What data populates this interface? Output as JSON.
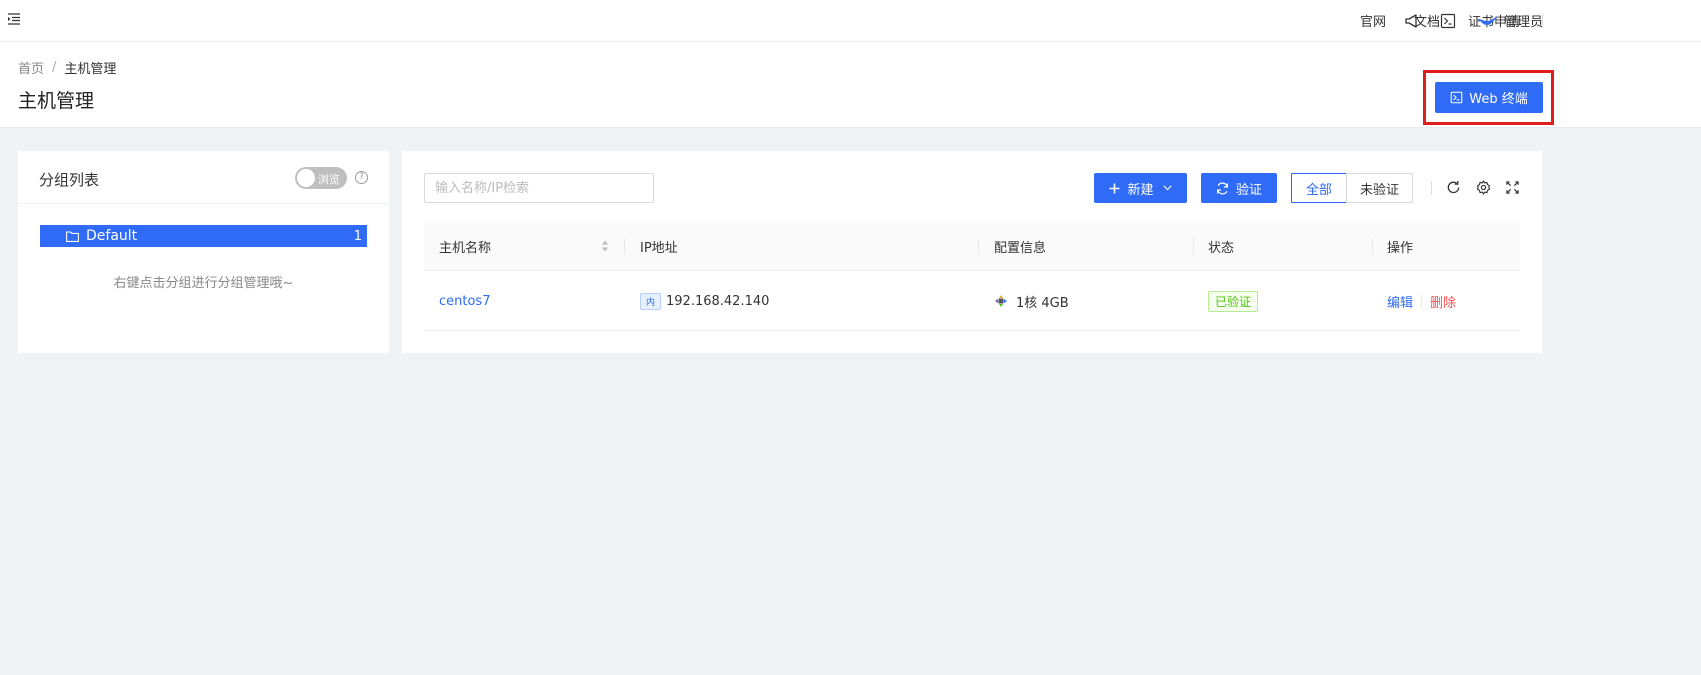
{
  "topbar": {
    "links": [
      "官网",
      "文档",
      "证书申请"
    ],
    "icons": [
      "menu-fold-icon",
      "notification-icon",
      "terminal-icon"
    ],
    "user_label": "管理员"
  },
  "header": {
    "breadcrumb": [
      "首页",
      "主机管理"
    ],
    "title": "主机管理",
    "web_terminal_label": "Web 终端"
  },
  "groups": {
    "title": "分组列表",
    "switch_label": "浏览",
    "items": [
      {
        "name": "Default",
        "count": "1"
      }
    ],
    "hint": "右键点击分组进行分组管理哦~"
  },
  "toolbar": {
    "search_placeholder": "输入名称/IP检索",
    "new_label": "新建",
    "verify_label": "验证",
    "filters": [
      "全部",
      "未验证"
    ],
    "active_filter": "全部"
  },
  "table": {
    "columns": [
      "主机名称",
      "IP地址",
      "配置信息",
      "状态",
      "操作"
    ],
    "rows": [
      {
        "name": "centos7",
        "ip_tag": "内",
        "ip": "192.168.42.140",
        "config": "1核 4GB",
        "status": "已验证",
        "actions": [
          "编辑",
          "删除"
        ]
      }
    ]
  },
  "colors": {
    "primary": "#2f6bf6",
    "danger": "#ff4d4f",
    "success": "#52c41a",
    "highlight": "#e01e1e"
  }
}
